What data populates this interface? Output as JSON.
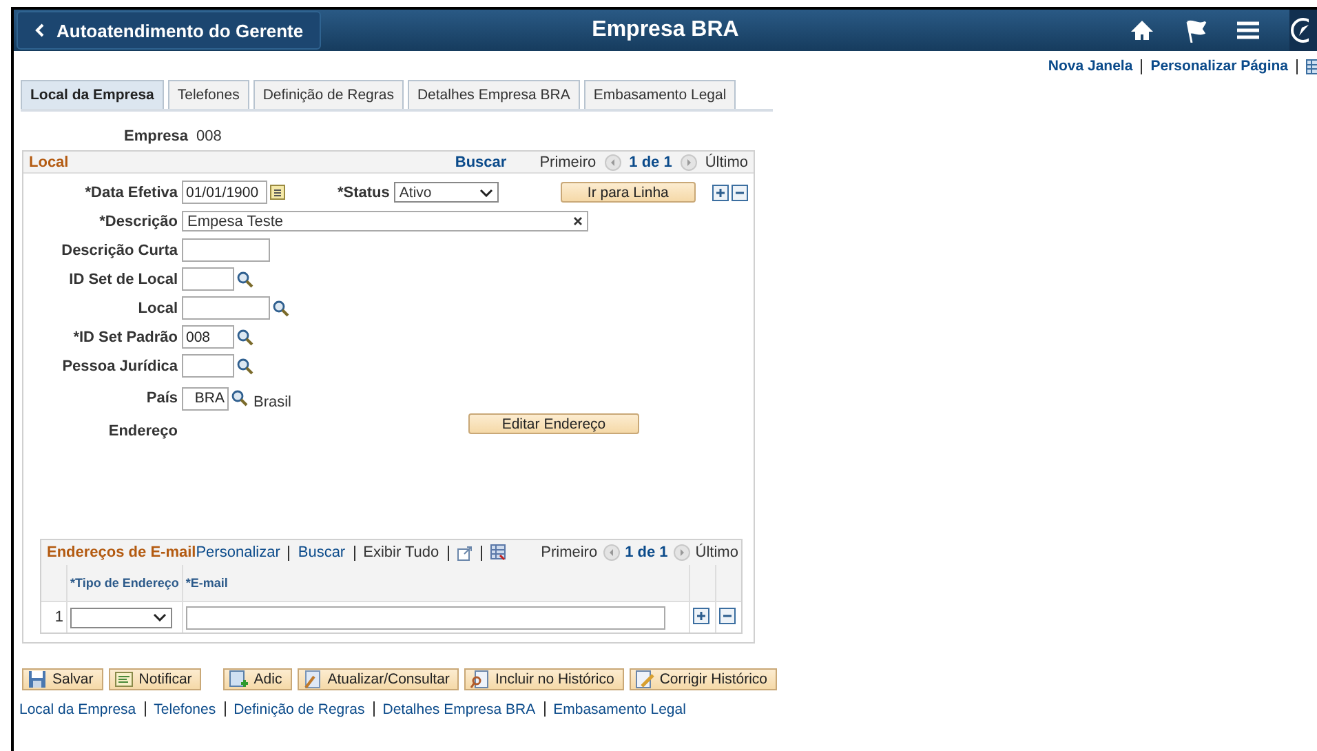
{
  "header": {
    "back_label": "Autoatendimento do Gerente",
    "title": "Empresa BRA"
  },
  "top_links": [
    "Nova Janela",
    "Personalizar Página"
  ],
  "tabs": [
    {
      "label": "Local da Empresa",
      "selected": true
    },
    {
      "label": "Telefones",
      "selected": false
    },
    {
      "label": "Definição de Regras",
      "selected": false
    },
    {
      "label": "Detalhes Empresa BRA",
      "selected": false
    },
    {
      "label": "Embasamento Legal",
      "selected": false
    }
  ],
  "empresa": {
    "label": "Empresa",
    "value": "008"
  },
  "local": {
    "title": "Local",
    "find": "Buscar",
    "first": "Primeiro",
    "count": "1 de 1",
    "last": "Último",
    "goto_button": "Ir para Linha",
    "effective_date": {
      "label": "*Data Efetiva",
      "value": "01/01/1900"
    },
    "status": {
      "label": "*Status",
      "value": "Ativo"
    },
    "fields": [
      {
        "kind": "clear",
        "label": "*Descrição",
        "value": "Empesa Teste"
      },
      {
        "kind": "text",
        "label": "Descrição Curta"
      },
      {
        "kind": "lookup",
        "label": "ID Set de Local"
      },
      {
        "kind": "lookup-wide",
        "label": "Local"
      },
      {
        "kind": "lookup",
        "label": "*ID Set Padrão",
        "value": "008"
      },
      {
        "kind": "lookup",
        "label": "Pessoa Jurídica"
      }
    ],
    "country": {
      "label": "País",
      "value": "BRA",
      "description": "Brasil"
    },
    "address": {
      "label": "Endereço",
      "button": "Editar Endereço"
    }
  },
  "email": {
    "title": "Endereços de E-mail",
    "links": [
      "Personalizar",
      "Buscar"
    ],
    "view_all": "Exibir Tudo",
    "first": "Primeiro",
    "count": "1 de 1",
    "last": "Último",
    "columns": [
      "*Tipo de Endereço",
      "*E-mail"
    ],
    "rows": [
      {
        "number": "1"
      }
    ]
  },
  "actions": [
    {
      "kind": "save",
      "label": "Salvar"
    },
    {
      "kind": "notify",
      "label": "Notificar"
    },
    {
      "kind": "add",
      "label": "Adic"
    },
    {
      "kind": "update",
      "label": "Atualizar/Consultar"
    },
    {
      "kind": "include",
      "label": "Incluir no Histórico"
    },
    {
      "kind": "correct",
      "label": "Corrigir Histórico"
    }
  ],
  "footer_links": [
    "Local da Empresa",
    "Telefones",
    "Definição de Regras",
    "Detalhes Empresa BRA",
    "Embasamento Legal"
  ]
}
